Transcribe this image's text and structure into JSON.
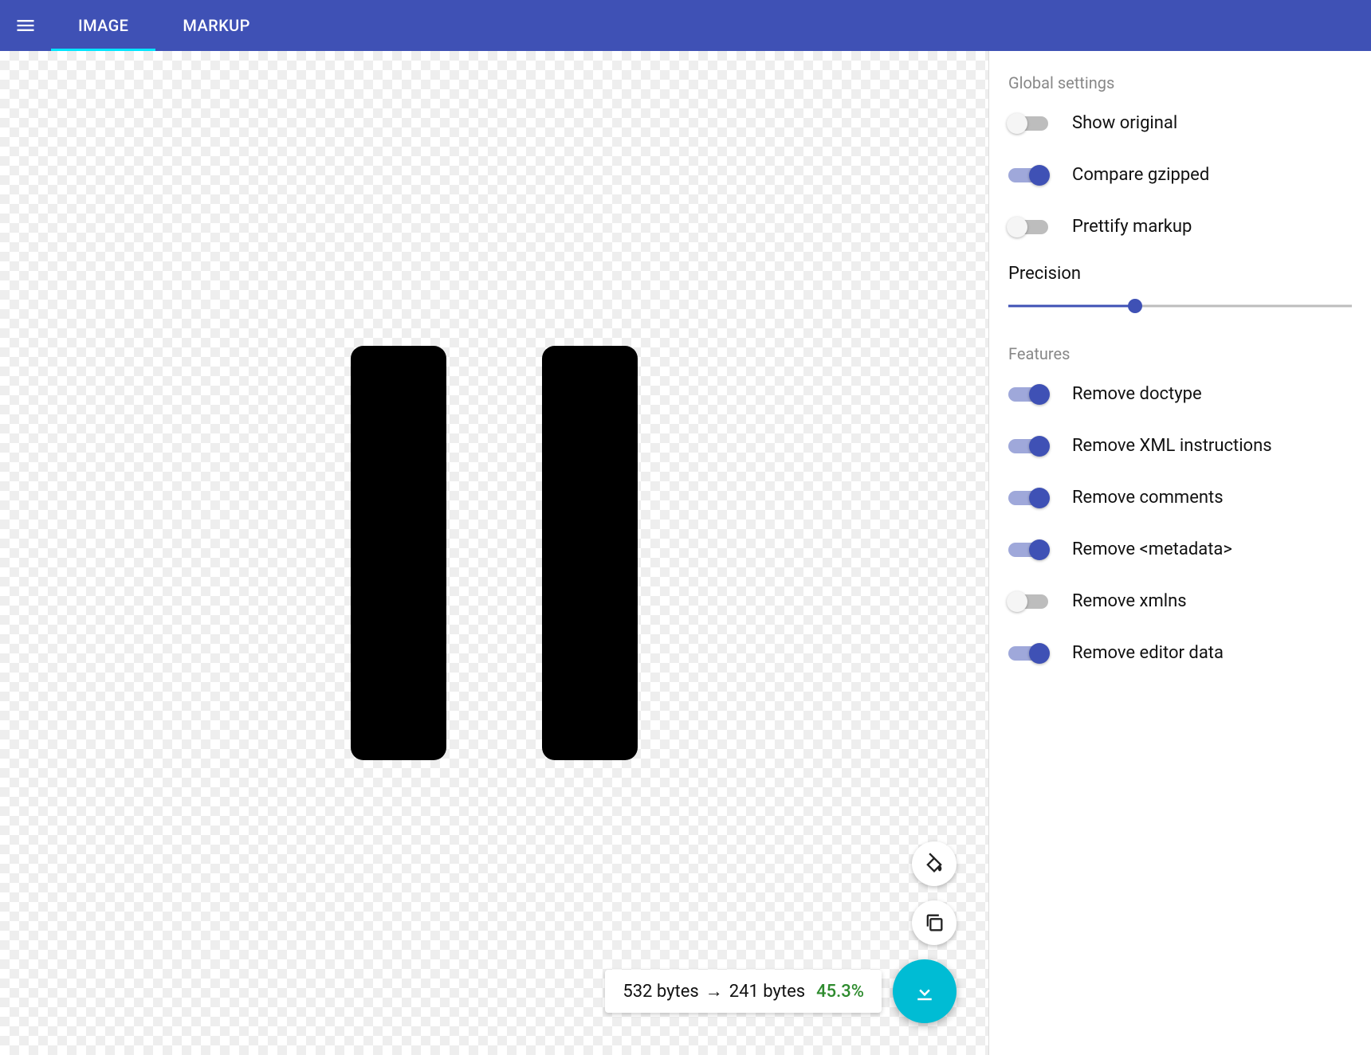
{
  "header": {
    "tab_image": "IMAGE",
    "tab_markup": "MARKUP"
  },
  "size": {
    "before": "532 bytes",
    "arrow": "→",
    "after": "241 bytes",
    "percent": "45.3%"
  },
  "settings": {
    "global_title": "Global settings",
    "precision_label": "Precision",
    "precision_percent": 37,
    "features_title": "Features",
    "toggles": {
      "show_original": {
        "label": "Show original",
        "on": false
      },
      "compare_gzipped": {
        "label": "Compare gzipped",
        "on": true
      },
      "prettify_markup": {
        "label": "Prettify markup",
        "on": false
      },
      "remove_doctype": {
        "label": "Remove doctype",
        "on": true
      },
      "remove_xml_instructions": {
        "label": "Remove XML instructions",
        "on": true
      },
      "remove_comments": {
        "label": "Remove comments",
        "on": true
      },
      "remove_metadata": {
        "label": "Remove <metadata>",
        "on": true
      },
      "remove_xmlns": {
        "label": "Remove xmlns",
        "on": false
      },
      "remove_editor_data": {
        "label": "Remove editor data",
        "on": true
      }
    }
  }
}
